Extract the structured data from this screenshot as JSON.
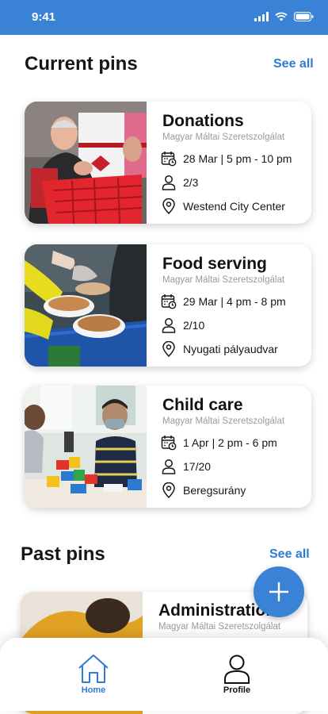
{
  "status_bar": {
    "time": "9:41",
    "icons": [
      "signal-icon",
      "wifi-icon",
      "battery-icon"
    ]
  },
  "current_pins": {
    "title": "Current pins",
    "see_all": "See all",
    "cards": [
      {
        "title": "Donations",
        "org": "Magyar Máltai Szeretszolgálat",
        "datetime": "28 Mar | 5 pm - 10 pm",
        "participants": "2/3",
        "location": "Westend City Center",
        "photo": "donations-photo"
      },
      {
        "title": "Food serving",
        "org": "Magyar Máltai Szeretszolgálat",
        "datetime": "29 Mar | 4 pm - 8 pm",
        "participants": "2/10",
        "location": "Nyugati pályaudvar",
        "photo": "food-serving-photo"
      },
      {
        "title": "Child care",
        "org": "Magyar Máltai Szeretszolgálat",
        "datetime": "1 Apr | 2 pm - 6 pm",
        "participants": "17/20",
        "location": "Beregsurány",
        "photo": "child-care-photo"
      }
    ]
  },
  "past_pins": {
    "title": "Past pins",
    "see_all": "See all",
    "cards": [
      {
        "title": "Administration",
        "org": "Magyar Máltai Szeretszolgálat",
        "photo": "administration-photo"
      }
    ]
  },
  "fab": {
    "icon": "plus-icon"
  },
  "bottom_nav": {
    "items": [
      {
        "label": "Home",
        "icon": "home-icon",
        "active": true
      },
      {
        "label": "Profile",
        "icon": "profile-icon",
        "active": false
      }
    ]
  },
  "colors": {
    "primary": "#3a82d6",
    "link": "#2f7bd1",
    "text": "#161616",
    "muted": "#9a9a9a"
  }
}
